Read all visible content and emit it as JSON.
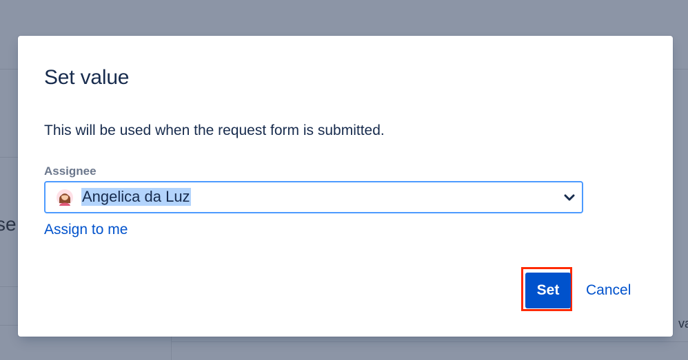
{
  "background": {
    "left_fragment": "se",
    "right_fragment": "va"
  },
  "modal": {
    "title": "Set value",
    "description": "This will be used when the request form is submitted.",
    "field": {
      "label": "Assignee",
      "selected_value": "Angelica da Luz",
      "avatar_icon": "user-avatar-icon",
      "dropdown_icon": "chevron-down-icon"
    },
    "assign_to_me_label": "Assign to me",
    "buttons": {
      "set_label": "Set",
      "cancel_label": "Cancel"
    }
  },
  "colors": {
    "overlay": "#8c95a6",
    "primary": "#0052cc",
    "focus_border": "#4c9aff",
    "text": "#172b4d",
    "label": "#6b778c",
    "selection_highlight": "#b3d4fc",
    "annotation": "#ff2a00"
  }
}
